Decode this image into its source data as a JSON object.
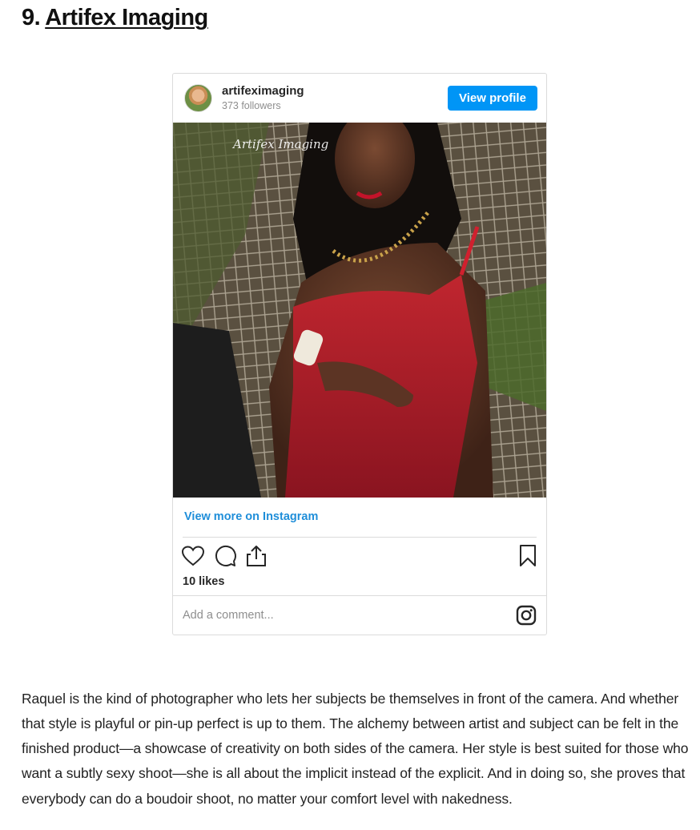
{
  "heading": {
    "number": "9.",
    "title": "Artifex Imaging"
  },
  "embed": {
    "username": "artifeximaging",
    "followers": "373 followers",
    "view_profile_label": "View profile",
    "photo_watermark": "Artifex Imaging",
    "view_more_label": "View more on Instagram",
    "likes": "10 likes",
    "comment_placeholder": "Add a comment...",
    "icons": [
      "heart-icon",
      "comment-icon",
      "share-icon",
      "bookmark-icon",
      "instagram-logo-icon"
    ],
    "accent_color": "#0095f6",
    "link_color": "#1f8ed9"
  },
  "article": {
    "paragraph": "Raquel is the kind of photographer who lets her subjects be themselves in front of the camera. And whether that style is playful or pin-up perfect is up to them. The alchemy between artist and subject can be felt in the finished product—a showcase of creativity on both sides of the camera. Her style is best suited for those who want a subtly sexy shoot—she is all about the implicit instead of the explicit. And in doing so, she proves that everybody can do a boudoir shoot, no matter your comfort level with nakedness."
  }
}
